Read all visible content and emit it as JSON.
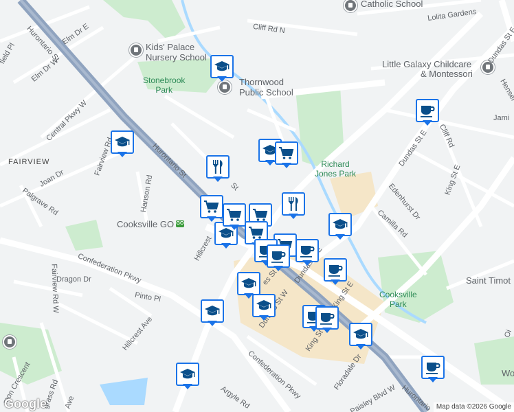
{
  "colors": {
    "land": "#f1f3f4",
    "road": "#ffffff",
    "road_outline": "#dadce0",
    "arterial": "#8fa3bf",
    "park": "#cdeccf",
    "water": "#aadaff",
    "commercial": "#f5e6c8",
    "marker_blue": "#1a73e8",
    "marker_icon": "#0b4f8a"
  },
  "labels": {
    "catholic_school": "Catholic School",
    "lolita_gardens": "Lolita Gardens",
    "cliff_rd_n": "Cliff Rd N",
    "dundas_st_e_top": "Dundas St E",
    "kids_palace": "Kids' Palace",
    "kids_palace_2": "Nursery School",
    "little_galaxy": "Little Galaxy Childcare",
    "little_galaxy_2": "& Montessori",
    "hensel": "Hensel",
    "jami": "Jami",
    "stonebrook": "Stonebrook",
    "stonebrook_2": "Park",
    "thornwood": "Thornwood",
    "thornwood_2": "Public School",
    "hurontario_top": "Hurontario St",
    "elm_dr_e": "Elm Dr E",
    "elm_dr_w": "Elm Dr W",
    "field_pl": "field Pl",
    "central_pkwy": "Central Pkwy W",
    "fairview_nbhd": "FAIRVIEW",
    "fairview_rd": "Fairview Rd",
    "joan_dr": "Joan Dr",
    "palgrave": "Palgrave Rd",
    "hanson": "Hanson Rd",
    "hurontario_mid": "Hurontario St",
    "richard_jones": "Richard",
    "richard_jones_2": "Jones Park",
    "dundas_st_e_right": "Dundas St E",
    "cliff_rd": "Cliff Rd",
    "king_st_e_right": "King St E",
    "edenhurst": "Edenhurst Dr",
    "camilla": "Camilla Rd",
    "cooksville_go": "Cooksville GO",
    "hillcrest_mid": "Hillcrest",
    "confederation_left": "Confederation Pkwy",
    "fairview_rd_w": "Fairview Rd W",
    "dragon": "Dragon Dr",
    "pinto": "Pinto Pl",
    "hillcrest_bottom": "Hillcrest Ave",
    "dundas_st_w": "Dundas St W",
    "dundas_st_e_mid": "Dundas St E",
    "king_st": "King St",
    "king_st_e_mid": "King St E",
    "saint_timothy": "Saint Timot",
    "cooksville_park": "Cooksville",
    "cooksville_park_2": "Park",
    "confederation_bottom": "Confederation Pkwy",
    "floradale": "Floradale Dr",
    "paisley": "Paisley Blvd W",
    "hurontario_bottom": "Hurontario",
    "argyle": "Argyle Rd",
    "mon_crescent": "mon Crescent",
    "grass_rd": "grass Rd",
    "ave": "Ave",
    "wo": "Wo",
    "oi": "Oi",
    "st_fragment": "St",
    "es_st_fragment": "es St"
  },
  "logo": "Google",
  "attribution": "Map data ©2026 Google",
  "markers": [
    {
      "type": "school"
    },
    {
      "type": "school"
    },
    {
      "type": "restaurant"
    },
    {
      "type": "school"
    },
    {
      "type": "shopping"
    },
    {
      "type": "cafe"
    },
    {
      "type": "shopping"
    },
    {
      "type": "restaurant"
    },
    {
      "type": "school"
    },
    {
      "type": "school"
    },
    {
      "type": "shopping"
    },
    {
      "type": "shopping"
    },
    {
      "type": "shopping"
    },
    {
      "type": "shopping"
    },
    {
      "type": "cafe"
    },
    {
      "type": "cafe"
    },
    {
      "type": "cafe"
    },
    {
      "type": "school"
    },
    {
      "type": "school"
    },
    {
      "type": "school"
    },
    {
      "type": "cafe"
    },
    {
      "type": "cafe"
    },
    {
      "type": "school"
    },
    {
      "type": "cafe"
    },
    {
      "type": "cafe"
    },
    {
      "type": "school"
    }
  ]
}
